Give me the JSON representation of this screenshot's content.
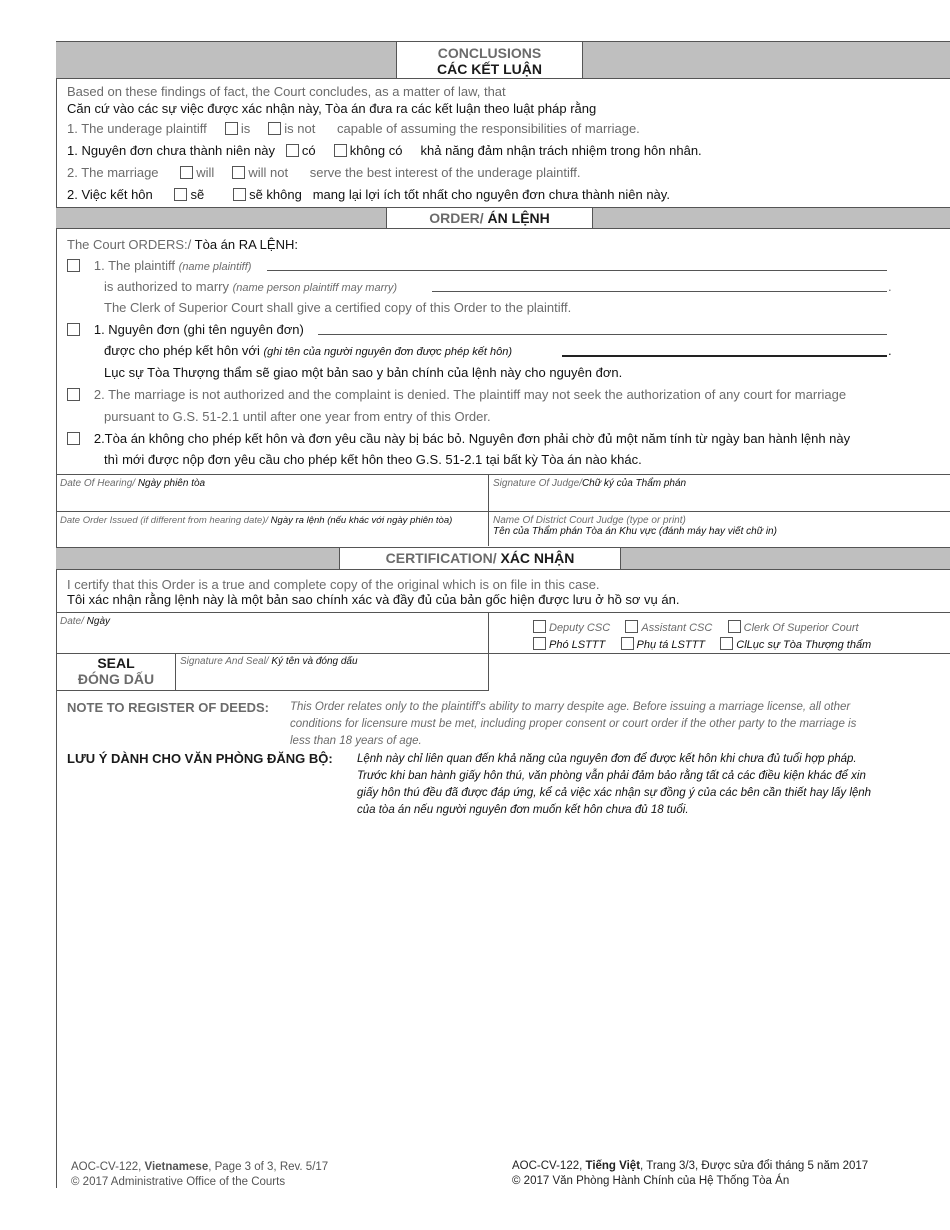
{
  "conclusions": {
    "title_en": "CONCLUSIONS",
    "title_vi": "CÁC KẾT LUẬN",
    "intro_en": "Based on these findings of fact, the Court concludes, as a matter of law, that",
    "intro_vi": "Căn cứ vào các sự việc được xác nhận này, Tòa án đưa ra các kết luận theo luật pháp rằng",
    "item1_en": {
      "prefix": "1. The underage plaintiff",
      "opt1": "is",
      "opt2": "is not",
      "suffix": "capable of assuming the responsibilities of marriage."
    },
    "item1_vi": {
      "prefix": "1. Nguyên đơn chưa thành niên này",
      "opt1": "có",
      "opt2": "không có",
      "suffix": "khả năng đảm nhận trách nhiệm trong hôn nhân."
    },
    "item2_en": {
      "prefix": "2. The marriage",
      "opt1": "will",
      "opt2": "will not",
      "suffix": "serve the best interest of the underage plaintiff."
    },
    "item2_vi": {
      "prefix": "2. Việc kết hôn",
      "opt1": "sẽ",
      "opt2": "sẽ không",
      "suffix": "mang lại lợi ích tốt nhất cho nguyên đơn chưa thành niên này."
    }
  },
  "order": {
    "title_en": "ORDER/",
    "title_vi": " ÁN LỆNH",
    "intro_en": "The Court ORDERS:/",
    "intro_vi": " Tòa án RA LỆNH:",
    "en1_line1": "1. The plaintiff",
    "en1_line1_hint": "(name plaintiff)",
    "en1_line2": "is authorized to marry",
    "en1_line2_hint": "(name person plaintiff may marry)",
    "en1_line3": "The Clerk of Superior Court shall give a certified copy of this Order to the plaintiff.",
    "vi1_line1": "1. Nguyên đơn (ghi tên nguyên đơn)",
    "vi1_line2": "được cho phép kết hôn với",
    "vi1_line2_hint": "(ghi tên của người nguyên đơn được phép kết hôn)",
    "vi1_line3": "Lục sự Tòa Thượng thẩm sẽ giao một bản sao y bản chính của lệnh này cho nguyên đơn.",
    "en2_line1": "2. The marriage is not authorized and the complaint is denied. The plaintiff may not seek the authorization of any court for marriage",
    "en2_line2": "pursuant to G.S. 51-2.1 until after one year from entry of this Order.",
    "vi2_line1": "2.Tòa án không cho phép kết hôn và đơn yêu cầu này bị bác bỏ. Nguyên đơn phải chờ đủ một năm tính từ ngày ban hành lệnh này",
    "vi2_line2": "thì mới được nộp đơn yêu cầu cho phép kết hôn theo G.S. 51-2.1 tại bất kỳ Tòa án nào khác."
  },
  "signature_fields": {
    "date_hearing_en": "Date Of Hearing/",
    "date_hearing_vi": " Ngày phiên tòa",
    "judge_sig_en": "Signature Of Judge/",
    "judge_sig_vi": "Chữ ký của Thẩm phán",
    "date_issued_en": "Date Order Issued (if different from hearing date)/",
    "date_issued_vi": " Ngày ra lệnh (nếu khác với ngày phiên tòa)",
    "judge_name_en": "Name Of District Court Judge (type or print)",
    "judge_name_vi": "Tên của Thẩm phán Tòa án Khu vực (đánh máy hay viết chữ in)"
  },
  "certification": {
    "title_en": "CERTIFICATION/",
    "title_vi": " XÁC NHẬN",
    "text_en": "I certify that this Order is a true and complete copy of the original which is on file in this case.",
    "text_vi": "Tôi xác nhận rằng lệnh này là một bản sao chính xác và đầy đủ của bản gốc hiện được lưu ở hồ sơ vụ án.",
    "date_en": "Date/",
    "date_vi": " Ngày",
    "roles_en": [
      "Deputy CSC",
      "Assistant CSC",
      "Clerk Of Superior Court"
    ],
    "roles_vi": [
      "Phó LSTTT",
      "Phụ tá LSTTT",
      "ClLục sự Tòa Thượng thẩm"
    ],
    "seal_en": "SEAL",
    "seal_vi": "ĐÓNG DẤU",
    "sig_seal_en": "Signature And Seal/",
    "sig_seal_vi": " Ký tên và đóng dấu"
  },
  "notes": {
    "en_head": "NOTE TO REGISTER OF DEEDS:",
    "en_lines": [
      "This Order relates only to the plaintiff's ability to marry despite age. Before issuing a marriage license, all other",
      "conditions for licensure must be met, including proper consent or court order if the other party to the marriage is",
      "less than 18 years of age."
    ],
    "vi_head": "LƯU Ý DÀNH CHO VĂN PHÒNG ĐĂNG BỘ:",
    "vi_lines": [
      "Lệnh này chỉ liên quan đến khả năng của nguyên đơn để được kết hôn khi chưa đủ tuổi hợp pháp.",
      "Trước khi ban hành giấy hôn thú, văn phòng vẫn phải đảm bảo rằng tất cả các điều kiện khác để xin",
      "giấy hôn thú đều đã được đáp ứng, kể cả việc xác nhận sự đồng ý của các bên cần thiết hay lấy lệnh",
      "của tòa án nếu người nguyên đơn muốn kết hôn chưa đủ 18 tuổi."
    ]
  },
  "footer": {
    "left_line1_a": "AOC-CV-122, ",
    "left_line1_b": "Vietnamese",
    "left_line1_c": ", Page 3 of 3, Rev. 5/17",
    "left_line2": "© 2017 Administrative Office of the Courts",
    "right_line1_a": "AOC-CV-122, ",
    "right_line1_b": "Tiếng Việt",
    "right_line1_c": ", Trang 3/3, Được sửa đổi tháng 5 năm 2017",
    "right_line2": "© 2017 Văn Phòng Hành Chính của Hệ Thống Tòa Án"
  }
}
